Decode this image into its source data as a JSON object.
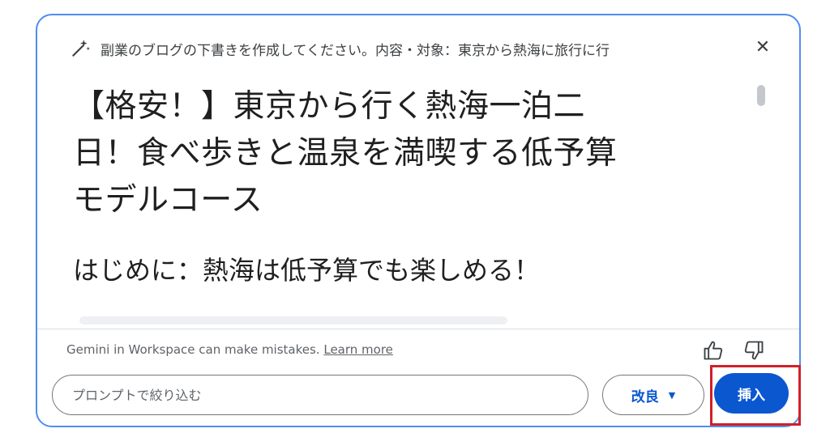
{
  "dialog": {
    "prompt_title": "副業のブログの下書きを作成してください。内容・対象：東京から熱海に旅行に行",
    "close_glyph": "✕"
  },
  "content": {
    "article_title_lines": [
      "【格安！】東京から行く熱海一泊二",
      "日！食べ歩きと温泉を満喫する低予算",
      "モデルコース"
    ],
    "section_heading": "はじめに：熱海は低予算でも楽しめる！"
  },
  "footer": {
    "disclaimer": "Gemini in Workspace can make mistakes.",
    "learn_more": "Learn more",
    "input_placeholder": "プロンプトで絞り込む",
    "refine_label": "改良",
    "refine_caret": "▼",
    "insert_label": "挿入"
  },
  "icons": {
    "wand": "magic-wand-icon",
    "close": "close-icon",
    "thumb_up": "thumb-up-icon",
    "thumb_down": "thumb-down-icon"
  },
  "colors": {
    "accent": "#0b57d0",
    "dialog_border": "#4f8ef0",
    "highlight": "#d0202a"
  }
}
